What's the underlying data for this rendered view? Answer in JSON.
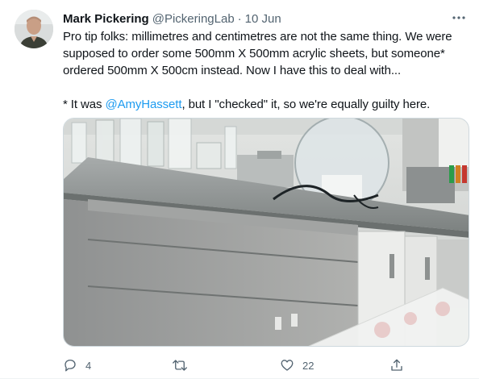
{
  "tweet": {
    "author_name": "Mark Pickering",
    "handle": "@PickeringLab",
    "separator": "·",
    "date": "10 Jun",
    "text_line1": "Pro tip folks: millimetres and centimetres are not the same thing. We were supposed to order some 500mm X 500mm acrylic sheets, but someone* ordered 500mm X 500cm instead. Now I have this to deal with...",
    "footnote_prefix": "* It was ",
    "footnote_mention": "@AmyHassett",
    "footnote_suffix": ", but I \"checked\" it, so we're equally guilty here.",
    "media_description": "Lab bench photo with oversized acrylic sheets"
  },
  "actions": {
    "reply_count": "4",
    "retweet_count": "",
    "like_count": "22"
  },
  "icons": {
    "more": "more-icon",
    "reply": "reply-icon",
    "retweet": "retweet-icon",
    "like": "like-icon",
    "share": "share-icon"
  },
  "colors": {
    "text": "#0f1419",
    "secondary": "#536471",
    "link": "#1d9bf0"
  }
}
